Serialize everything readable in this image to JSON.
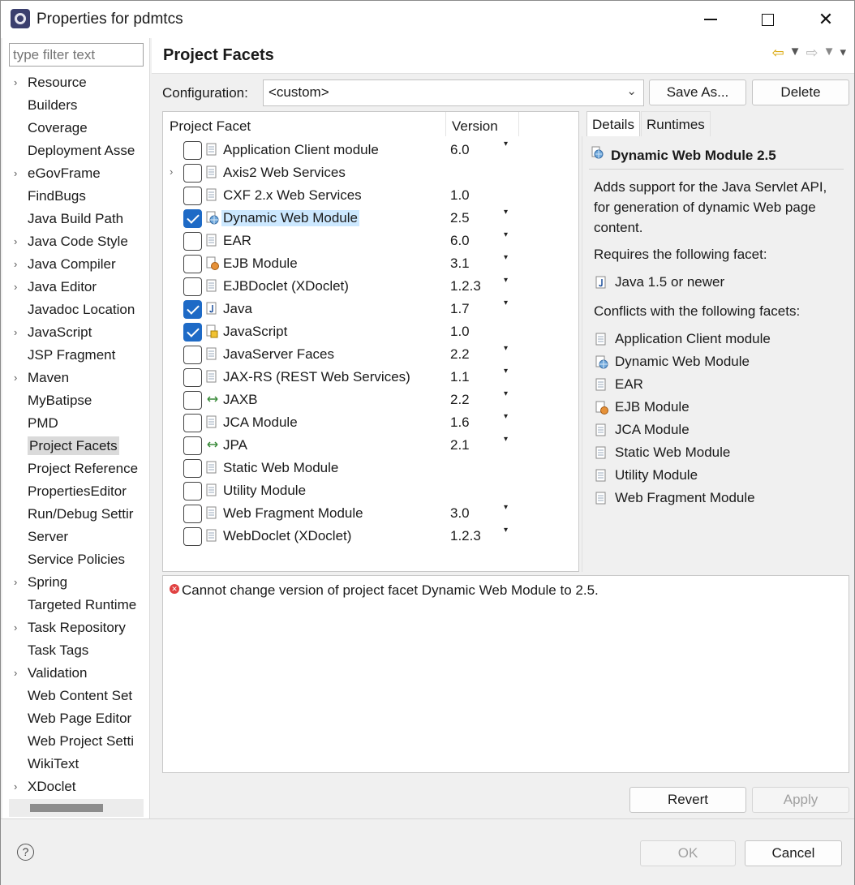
{
  "window": {
    "title": "Properties for pdmtcs"
  },
  "filter": {
    "placeholder": "type filter text"
  },
  "tree": [
    {
      "label": "Resource",
      "expandable": true
    },
    {
      "label": "Builders",
      "expandable": false
    },
    {
      "label": "Coverage",
      "expandable": false
    },
    {
      "label": "Deployment Asse",
      "expandable": false
    },
    {
      "label": "eGovFrame",
      "expandable": true
    },
    {
      "label": "FindBugs",
      "expandable": false
    },
    {
      "label": "Java Build Path",
      "expandable": false
    },
    {
      "label": "Java Code Style",
      "expandable": true
    },
    {
      "label": "Java Compiler",
      "expandable": true
    },
    {
      "label": "Java Editor",
      "expandable": true
    },
    {
      "label": "Javadoc Location",
      "expandable": false
    },
    {
      "label": "JavaScript",
      "expandable": true
    },
    {
      "label": "JSP Fragment",
      "expandable": false
    },
    {
      "label": "Maven",
      "expandable": true
    },
    {
      "label": "MyBatipse",
      "expandable": false
    },
    {
      "label": "PMD",
      "expandable": false
    },
    {
      "label": "Project Facets",
      "expandable": false,
      "selected": true
    },
    {
      "label": "Project Reference",
      "expandable": false
    },
    {
      "label": "PropertiesEditor",
      "expandable": false
    },
    {
      "label": "Run/Debug Settir",
      "expandable": false
    },
    {
      "label": "Server",
      "expandable": false
    },
    {
      "label": "Service Policies",
      "expandable": false
    },
    {
      "label": "Spring",
      "expandable": true
    },
    {
      "label": "Targeted Runtime",
      "expandable": false
    },
    {
      "label": "Task Repository",
      "expandable": true
    },
    {
      "label": "Task Tags",
      "expandable": false
    },
    {
      "label": "Validation",
      "expandable": true
    },
    {
      "label": "Web Content Set",
      "expandable": false
    },
    {
      "label": "Web Page Editor",
      "expandable": false
    },
    {
      "label": "Web Project Setti",
      "expandable": false
    },
    {
      "label": "WikiText",
      "expandable": false
    },
    {
      "label": "XDoclet",
      "expandable": true
    }
  ],
  "page": {
    "title": "Project Facets"
  },
  "configuration": {
    "label": "Configuration:",
    "value": "<custom>",
    "save_as": "Save As...",
    "delete": "Delete"
  },
  "facets": {
    "header_facet": "Project Facet",
    "header_version": "Version",
    "rows": [
      {
        "name": "Application Client module",
        "version": "6.0",
        "checked": false,
        "dropdown": true,
        "icon": "document-icon"
      },
      {
        "name": "Axis2 Web Services",
        "version": "",
        "checked": false,
        "dropdown": false,
        "expandable": true,
        "icon": "document-icon"
      },
      {
        "name": "CXF 2.x Web Services",
        "version": "1.0",
        "checked": false,
        "dropdown": false,
        "icon": "document-icon"
      },
      {
        "name": "Dynamic Web Module",
        "version": "2.5",
        "checked": true,
        "dropdown": true,
        "selected": true,
        "icon": "web-module-icon"
      },
      {
        "name": "EAR",
        "version": "6.0",
        "checked": false,
        "dropdown": true,
        "icon": "document-icon"
      },
      {
        "name": "EJB Module",
        "version": "3.1",
        "checked": false,
        "dropdown": true,
        "icon": "ejb-icon"
      },
      {
        "name": "EJBDoclet (XDoclet)",
        "version": "1.2.3",
        "checked": false,
        "dropdown": true,
        "icon": "document-icon"
      },
      {
        "name": "Java",
        "version": "1.7",
        "checked": true,
        "dropdown": true,
        "icon": "java-icon"
      },
      {
        "name": "JavaScript",
        "version": "1.0",
        "checked": true,
        "dropdown": false,
        "icon": "javascript-icon"
      },
      {
        "name": "JavaServer Faces",
        "version": "2.2",
        "checked": false,
        "dropdown": true,
        "icon": "document-icon"
      },
      {
        "name": "JAX-RS (REST Web Services)",
        "version": "1.1",
        "checked": false,
        "dropdown": true,
        "icon": "document-icon"
      },
      {
        "name": "JAXB",
        "version": "2.2",
        "checked": false,
        "dropdown": true,
        "icon": "arrows-icon"
      },
      {
        "name": "JCA Module",
        "version": "1.6",
        "checked": false,
        "dropdown": true,
        "icon": "document-icon"
      },
      {
        "name": "JPA",
        "version": "2.1",
        "checked": false,
        "dropdown": true,
        "icon": "arrows-icon"
      },
      {
        "name": "Static Web Module",
        "version": "",
        "checked": false,
        "dropdown": false,
        "icon": "document-icon"
      },
      {
        "name": "Utility Module",
        "version": "",
        "checked": false,
        "dropdown": false,
        "icon": "document-icon"
      },
      {
        "name": "Web Fragment Module",
        "version": "3.0",
        "checked": false,
        "dropdown": true,
        "icon": "document-icon"
      },
      {
        "name": "WebDoclet (XDoclet)",
        "version": "1.2.3",
        "checked": false,
        "dropdown": true,
        "icon": "document-icon"
      }
    ]
  },
  "details": {
    "tabs": [
      "Details",
      "Runtimes"
    ],
    "title": "Dynamic Web Module 2.5",
    "description": "Adds support for the Java Servlet API, for generation of dynamic Web page content.",
    "requires_label": "Requires the following facet:",
    "requires": [
      {
        "name": "Java 1.5 or newer",
        "icon": "java-icon"
      }
    ],
    "conflicts_label": "Conflicts with the following facets:",
    "conflicts": [
      {
        "name": "Application Client module",
        "icon": "document-icon"
      },
      {
        "name": "Dynamic Web Module",
        "icon": "web-module-icon"
      },
      {
        "name": "EAR",
        "icon": "document-icon"
      },
      {
        "name": "EJB Module",
        "icon": "ejb-icon"
      },
      {
        "name": "JCA Module",
        "icon": "document-icon"
      },
      {
        "name": "Static Web Module",
        "icon": "document-icon"
      },
      {
        "name": "Utility Module",
        "icon": "document-icon"
      },
      {
        "name": "Web Fragment Module",
        "icon": "document-icon"
      }
    ]
  },
  "message": {
    "text": "Cannot change version of project facet Dynamic Web Module to 2.5.",
    "icon": "error-icon"
  },
  "buttons": {
    "revert": "Revert",
    "apply": "Apply",
    "ok": "OK",
    "cancel": "Cancel",
    "help": "?"
  },
  "colors": {
    "accent": "#1e6ac6",
    "selection": "#cce8ff",
    "error": "#e04040"
  }
}
